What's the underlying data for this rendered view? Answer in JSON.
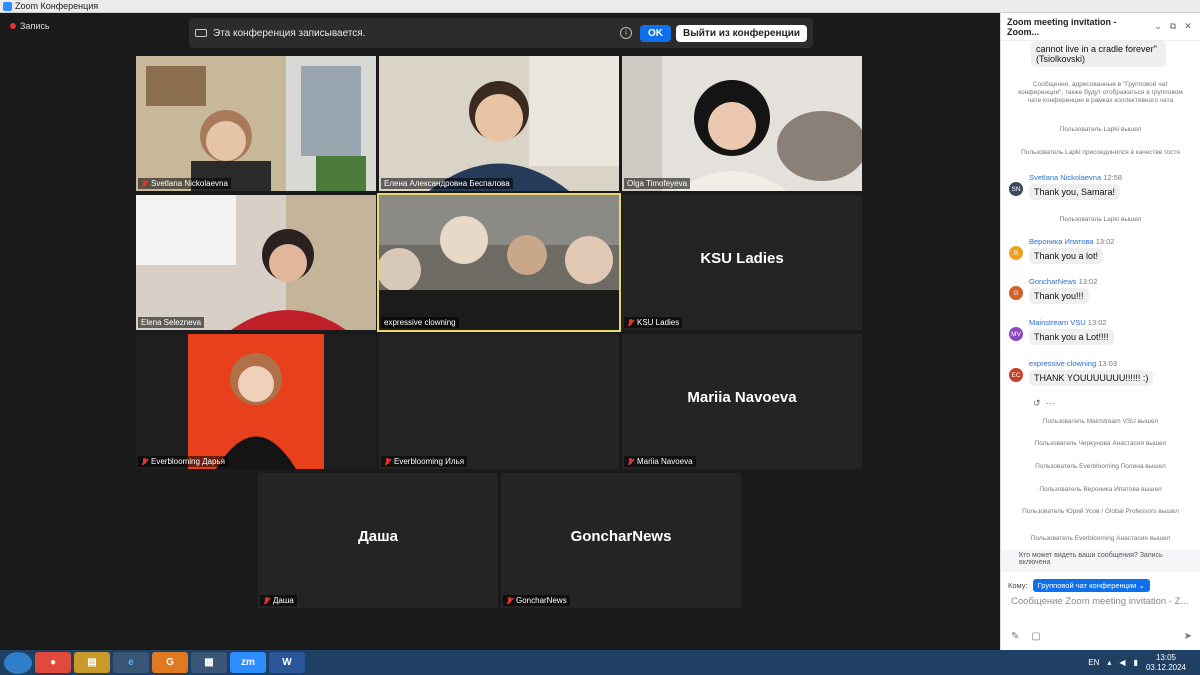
{
  "window": {
    "title": "Zoom Конференция"
  },
  "recording": {
    "label": "Запись"
  },
  "banner": {
    "text": "Эта конференция записывается.",
    "ok_label": "OK",
    "leave_label": "Выйти из конференции"
  },
  "tiles": [
    {
      "name": "Svetlana Nickolaevna",
      "big": ""
    },
    {
      "name": "Елена Александровна Беспалова",
      "big": ""
    },
    {
      "name": "Olga Timofeyeva",
      "big": ""
    },
    {
      "name": "Elena Selezneva",
      "big": ""
    },
    {
      "name": "expressive clowning",
      "big": ""
    },
    {
      "name": "KSU Ladies",
      "big": "KSU Ladies"
    },
    {
      "name": "Everblooming Дарья",
      "big": ""
    },
    {
      "name": "Everblooming Илья",
      "big": ""
    },
    {
      "name": "Mariia Navoeva",
      "big": "Mariia Navoeva"
    },
    {
      "name": "Даша",
      "big": "Даша"
    },
    {
      "name": "GoncharNews",
      "big": "GoncharNews"
    }
  ],
  "chat": {
    "title": "Zoom meeting invitation - Zoom...",
    "top_bubble": "cannot live in a cradle forever\"(Tsiolkovski)",
    "notice": "Сообщения, адресованные в \"Групповой чат конференции\", также будут отображаться в групповом чате конференции в рамках коллективного чата",
    "sys1": "Пользователь Lapki вышел",
    "sys2": "Пользователь Lapki присоединился в качестве гостя",
    "sys3": "Пользователь Lapki вышел",
    "messages": [
      {
        "initials": "SN",
        "color": "#3a4a5c",
        "sender": "Svetlana Nickolaevna",
        "time": "12:58",
        "text": "Thank you, Samara!"
      },
      {
        "initials": "В",
        "color": "#f0a020",
        "sender": "Вероника Ипатова",
        "time": "13:02",
        "text": "Thank you a lot!"
      },
      {
        "initials": "G",
        "color": "#d0602a",
        "sender": "GoncharNews",
        "time": "13:02",
        "text": "Thank you!!!"
      },
      {
        "initials": "MV",
        "color": "#8a4ab8",
        "sender": "Mainstream VSU",
        "time": "13:02",
        "text": "Thank you a Lot!!!!"
      },
      {
        "initials": "EC",
        "color": "#c4402a",
        "sender": "expressive clowning",
        "time": "13:03",
        "text": "THANK YOUUUUUUU!!!!!! :)"
      }
    ],
    "leave_events": [
      "Пользователь Mainstream VSU вышел",
      "Пользователь Чиркунова Анастасия вышел",
      "Пользователь Everblooming Полина вышел",
      "Пользователь Вероника Ипатова вышел",
      "Пользователь Юрий Усов / Global Professors вышел",
      "Пользователь Everblooming Анастасия вышел"
    ],
    "who_can_see": "Кто может видеть ваши сообщения? Запись включена",
    "to_label": "Кому:",
    "to_value": "Групповой чат конференции",
    "input_placeholder": "Сообщение Zoom meeting invitation - Z..."
  },
  "taskbar": {
    "lang": "EN",
    "time": "13:05",
    "date": "03.12.2024"
  }
}
